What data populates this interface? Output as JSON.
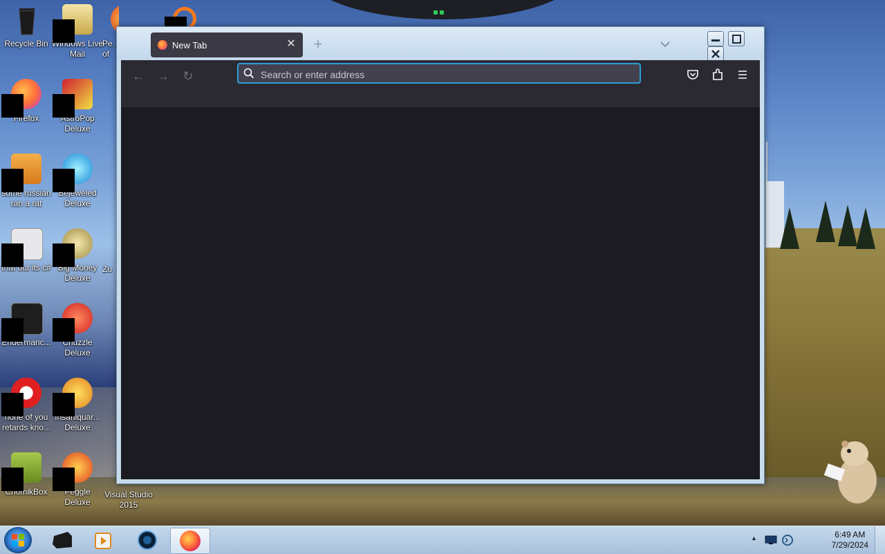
{
  "desktop": {
    "icons": [
      {
        "label": "Recycle Bin"
      },
      {
        "label": "Windows Live Mail"
      },
      {
        "label": "Pe…of"
      },
      {
        "label": "Firefox"
      },
      {
        "label": "AstroPop Deluxe"
      },
      {
        "label": "some russian ran a rat"
      },
      {
        "label": "Bejeweled Deluxe"
      },
      {
        "label": "that but its c#"
      },
      {
        "label": "Big Money Deluxe"
      },
      {
        "label": "Zu"
      },
      {
        "label": "Endermanc..."
      },
      {
        "label": "Chuzzle Deluxe"
      },
      {
        "label": "none of you retards kno..."
      },
      {
        "label": "Insaniquar... Deluxe"
      },
      {
        "label": "ChomikBox"
      },
      {
        "label": "Peggle Deluxe"
      },
      {
        "label": "Visual Studio 2015"
      }
    ]
  },
  "browser": {
    "tab": {
      "label": "New Tab",
      "close": "✕",
      "favicon": "firefox-logo-icon"
    },
    "new_tab_button": "+",
    "urlbar": {
      "placeholder": "Search or enter address",
      "value": ""
    },
    "nav": {
      "back": "←",
      "forward": "→",
      "reload": "↻"
    },
    "toolbar_icons": [
      "pocket-icon",
      "extensions-icon",
      "menu-icon"
    ],
    "theme": {
      "content_bg": "#1c1b22",
      "toolbar_bg": "#2b2a33",
      "focus_ring": "#2d9fd9"
    }
  },
  "taskbar": {
    "clock": {
      "time": "6:49 AM",
      "date": "7/29/2024"
    },
    "tray_arrow": "▲",
    "items": [
      "app-icon",
      "media-player-icon",
      "globe-app-icon",
      "firefox-icon"
    ]
  }
}
